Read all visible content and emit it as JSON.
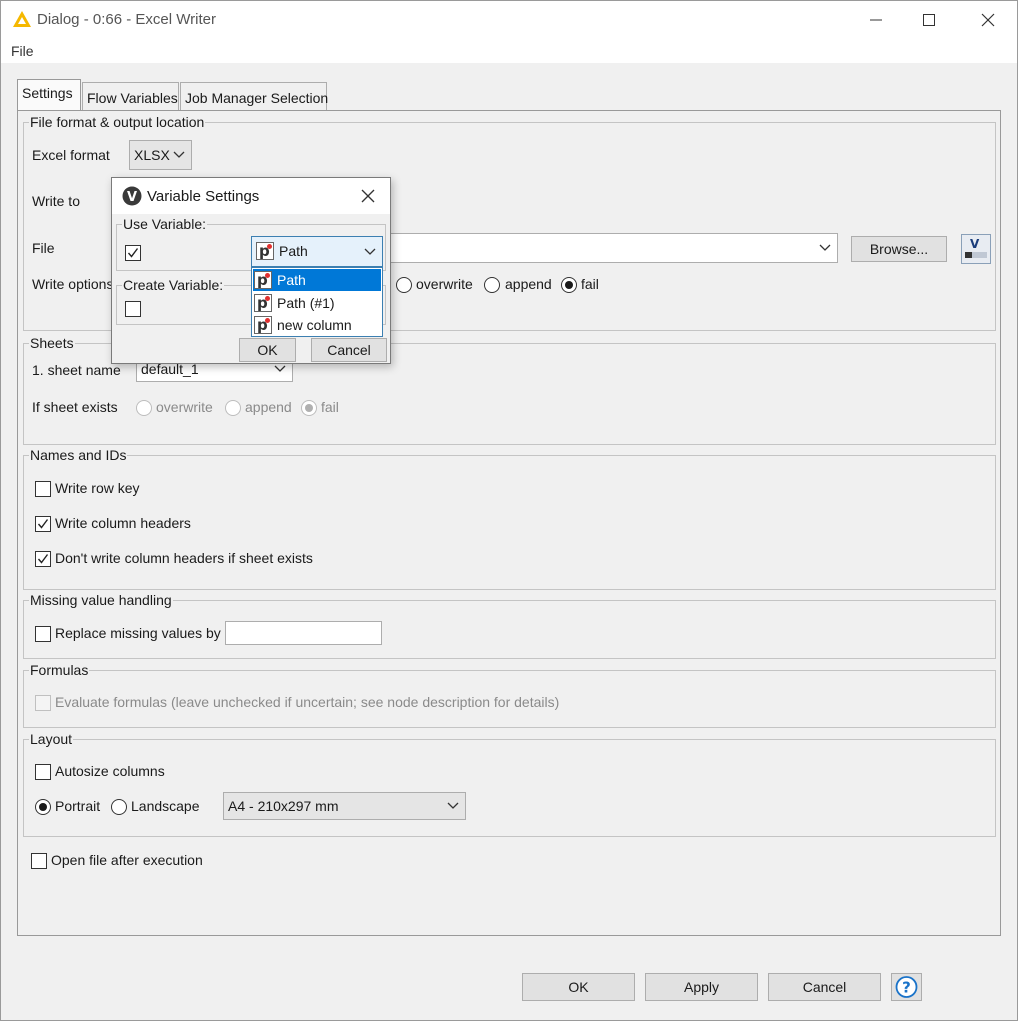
{
  "window": {
    "title": "Dialog - 0:66 - Excel Writer"
  },
  "menu": {
    "file": "File"
  },
  "tabs": [
    {
      "label": "Settings",
      "active": true
    },
    {
      "label": "Flow Variables",
      "active": false
    },
    {
      "label": "Job Manager Selection",
      "active": false
    }
  ],
  "file_format": {
    "legend": "File format & output location",
    "excel_format_label": "Excel format",
    "excel_format_value": "XLSX",
    "write_to_label": "Write to",
    "file_label": "File",
    "file_value": "",
    "browse_label": "Browse...",
    "write_options_label": "Write options",
    "write_options": [
      "overwrite",
      "append",
      "fail"
    ],
    "write_options_selected": "fail"
  },
  "sheets": {
    "legend": "Sheets",
    "sheet_name_label": "1. sheet name",
    "sheet_name_value": "default_1",
    "if_exists_label": "If sheet exists",
    "if_exists_options": [
      "overwrite",
      "append",
      "fail"
    ],
    "if_exists_selected": "fail"
  },
  "names_ids": {
    "legend": "Names and IDs",
    "write_row_key": {
      "label": "Write row key",
      "checked": false
    },
    "write_column_headers": {
      "label": "Write column headers",
      "checked": true
    },
    "dont_write_headers": {
      "label": "Don't write column headers if sheet exists",
      "checked": true
    }
  },
  "missing": {
    "legend": "Missing value handling",
    "replace": {
      "label": "Replace missing values by",
      "checked": false,
      "value": ""
    }
  },
  "formulas": {
    "legend": "Formulas",
    "evaluate": {
      "label": "Evaluate formulas (leave unchecked if uncertain; see node description for details)",
      "checked": false
    }
  },
  "layout": {
    "legend": "Layout",
    "autosize": {
      "label": "Autosize columns",
      "checked": false
    },
    "portrait_label": "Portrait",
    "landscape_label": "Landscape",
    "orientation_selected": "Portrait",
    "paper_size": "A4 - 210x297 mm"
  },
  "open_after": {
    "label": "Open file after execution",
    "checked": false
  },
  "footer": {
    "ok": "OK",
    "apply": "Apply",
    "cancel": "Cancel"
  },
  "variable_dialog": {
    "title": "Variable Settings",
    "use_variable_legend": "Use Variable:",
    "use_variable_checked": true,
    "selected_variable": "Path",
    "create_variable_legend": "Create Variable:",
    "create_variable_checked": false,
    "ok": "OK",
    "cancel": "Cancel",
    "options": [
      "Path",
      "Path (#1)",
      "new column"
    ]
  },
  "colors": {
    "selection": "#0078d7",
    "focus": "#3c7fb1",
    "knime_warning": "#f5b800"
  }
}
